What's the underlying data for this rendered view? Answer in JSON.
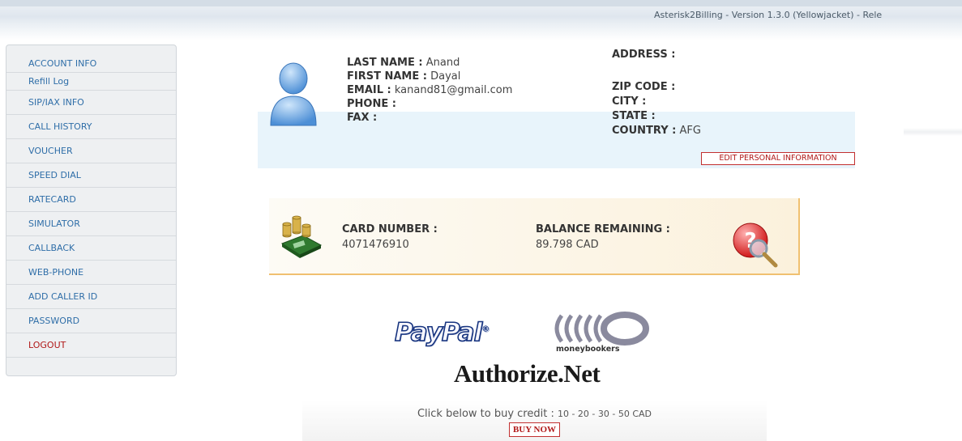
{
  "header": {
    "title": "Asterisk2Billing - Version 1.3.0 (Yellowjacket) - Rele"
  },
  "sidebar": {
    "items": [
      {
        "label": "ACCOUNT INFO"
      },
      {
        "label": "Refill Log"
      },
      {
        "label": "SIP/IAX INFO"
      },
      {
        "label": "CALL HISTORY"
      },
      {
        "label": "VOUCHER"
      },
      {
        "label": "SPEED DIAL"
      },
      {
        "label": "RATECARD"
      },
      {
        "label": "SIMULATOR"
      },
      {
        "label": "CALLBACK"
      },
      {
        "label": "WEB-PHONE"
      },
      {
        "label": "ADD CALLER ID"
      },
      {
        "label": "PASSWORD"
      },
      {
        "label": "LOGOUT"
      }
    ]
  },
  "profile": {
    "last_name_label": "LAST NAME :",
    "last_name": "Anand",
    "first_name_label": "FIRST NAME :",
    "first_name": "Dayal",
    "email_label": "EMAIL :",
    "email": "kanand81@gmail.com",
    "phone_label": "PHONE :",
    "phone": "",
    "fax_label": "FAX :",
    "fax": "",
    "address_label": "ADDRESS :",
    "address": "",
    "zip_label": "ZIP CODE :",
    "zip": "",
    "city_label": "CITY :",
    "city": "",
    "state_label": "STATE :",
    "state": "",
    "country_label": "COUNTRY :",
    "country": "AFG",
    "edit_button": "EDIT PERSONAL INFORMATION"
  },
  "card": {
    "number_label": "CARD NUMBER :",
    "number": "4071476910",
    "balance_label": "BALANCE REMAINING :",
    "balance": "89.798 CAD"
  },
  "payment": {
    "paypal": "PayPal",
    "moneybookers": "moneybookers",
    "authorize": "Authorize.Net"
  },
  "buy": {
    "text": "Click below to buy credit : ",
    "amounts": "10 - 20 - 30 - 50 CAD",
    "button": "BUY NOW"
  },
  "colors": {
    "link_blue": "#2f6ea8",
    "logout_red": "#b01818",
    "profile_band": "#e8f4fb",
    "card_border": "#f0c070"
  }
}
